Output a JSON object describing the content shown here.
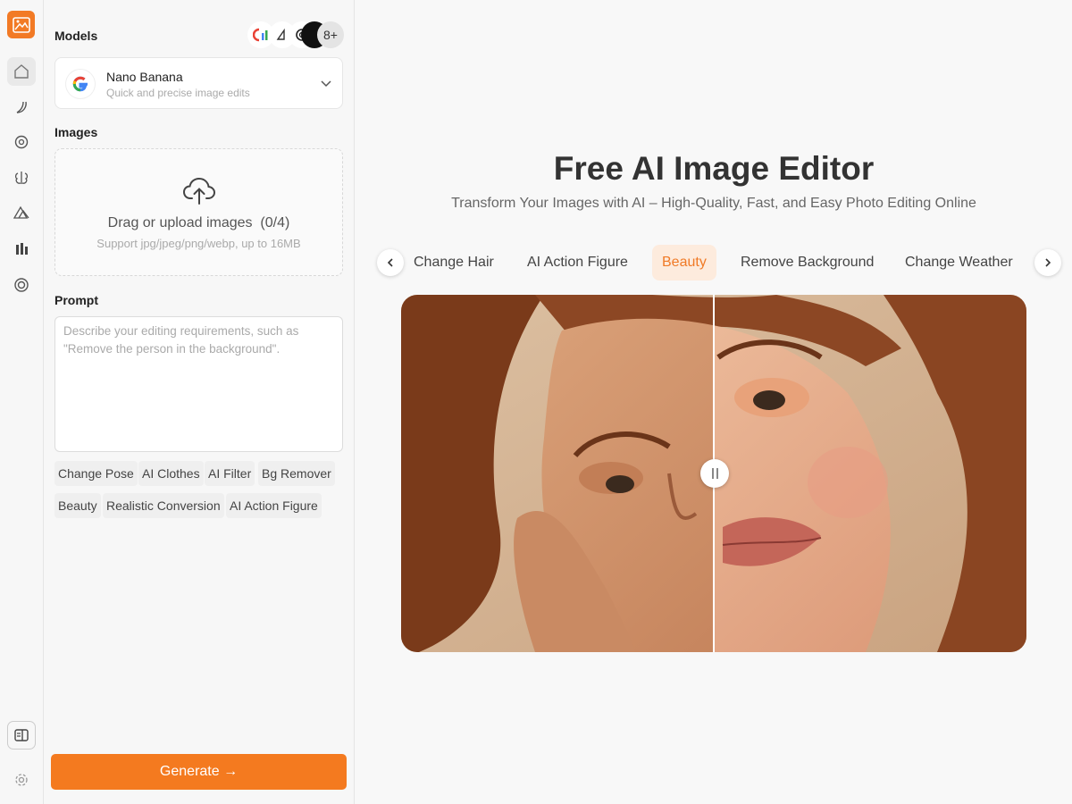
{
  "sidebar": {
    "nav": [
      "home-icon",
      "banana-icon",
      "openai-icon",
      "brain-icon",
      "mountain-icon",
      "bars-icon",
      "target-icon"
    ],
    "bottom": [
      "sidebar-toggle-icon",
      "gear-icon"
    ]
  },
  "panel": {
    "models_label": "Models",
    "model_logos_more": "8+",
    "model": {
      "name": "Nano Banana",
      "description": "Quick and precise image edits"
    },
    "images_label": "Images",
    "upload": {
      "title": "Drag or upload images",
      "count": "(0/4)",
      "subtitle": "Support jpg/jpeg/png/webp, up to 16MB"
    },
    "prompt_label": "Prompt",
    "prompt_placeholder": "Describe your editing requirements, such as \"Remove the person in the background\".",
    "chips": [
      "Change Pose",
      "AI Clothes",
      "AI Filter",
      "Bg Remover",
      "Beauty",
      "Realistic Conversion",
      "AI Action Figure"
    ],
    "generate_label": "Generate →"
  },
  "main": {
    "title": "Free AI Image Editor",
    "subtitle": "Transform Your Images with AI – High-Quality, Fast, and Easy Photo Editing Online",
    "tabs": [
      "Change Hair",
      "AI Action Figure",
      "Beauty",
      "Remove Background",
      "Change Weather"
    ],
    "active_tab": "Beauty",
    "compare_split": 0.5
  },
  "colors": {
    "accent": "#f47a1f",
    "active_tab_bg": "#fdebdd"
  }
}
